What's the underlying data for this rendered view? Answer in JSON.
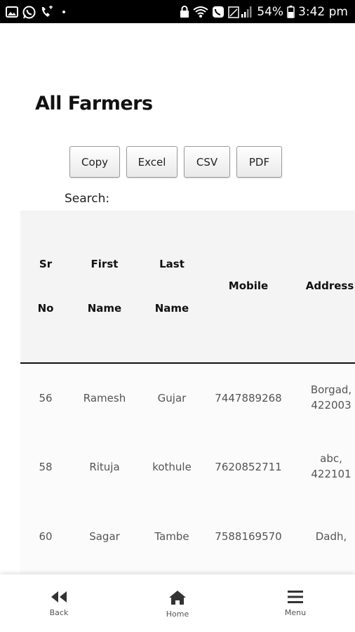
{
  "status_bar": {
    "battery": "54%",
    "time": "3:42 pm",
    "left_icons": [
      "gallery-icon",
      "whatsapp-icon",
      "call-icon"
    ],
    "right_icons": [
      "lock-icon",
      "wifi-call-icon",
      "chat-icon",
      "signal-icon"
    ]
  },
  "page": {
    "title": "All Farmers"
  },
  "export_buttons": {
    "copy": "Copy",
    "excel": "Excel",
    "csv": "CSV",
    "pdf": "PDF"
  },
  "search": {
    "label": "Search:"
  },
  "table": {
    "headers": [
      {
        "line1": "Sr",
        "line2": "No"
      },
      {
        "line1": "First",
        "line2": "Name"
      },
      {
        "line1": "Last",
        "line2": "Name"
      },
      {
        "line1": "Mobile",
        "line2": ""
      },
      {
        "line1": "Address",
        "line2": ""
      }
    ],
    "rows": [
      {
        "sr": "56",
        "first": "Ramesh",
        "last": "Gujar",
        "mobile": "7447889268",
        "address_line1": "Borgad,",
        "address_line2": "422003"
      },
      {
        "sr": "58",
        "first": "Rituja",
        "last": "kothule",
        "mobile": "7620852711",
        "address_line1": "abc,",
        "address_line2": "422101"
      },
      {
        "sr": "60",
        "first": "Sagar",
        "last": "Tambe",
        "mobile": "7588169570",
        "address_line1": "Dadh,",
        "address_line2": ""
      }
    ]
  },
  "bottom_nav": {
    "back": "Back",
    "home": "Home",
    "menu": "Menu"
  }
}
